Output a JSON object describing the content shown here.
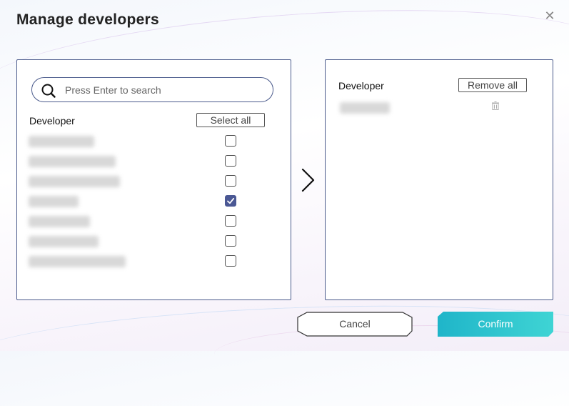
{
  "dialog": {
    "title": "Manage developers",
    "close_icon": "close-icon"
  },
  "available": {
    "search": {
      "placeholder": "Press Enter to search",
      "value": ""
    },
    "column_label": "Developer",
    "select_all_label": "Select all",
    "rows": [
      {
        "checked": false
      },
      {
        "checked": false
      },
      {
        "checked": false
      },
      {
        "checked": true
      },
      {
        "checked": false
      },
      {
        "checked": false
      },
      {
        "checked": false
      }
    ]
  },
  "transfer_icon": "chevron-right-icon",
  "selected": {
    "column_label": "Developer",
    "remove_all_label": "Remove all",
    "delete_icon": "trash-icon"
  },
  "footer": {
    "cancel_label": "Cancel",
    "confirm_label": "Confirm"
  },
  "colors": {
    "accent": "#4b5894",
    "border": "#4b5b8c",
    "confirm_start": "#1fb5c9",
    "confirm_end": "#3fd4d4"
  }
}
